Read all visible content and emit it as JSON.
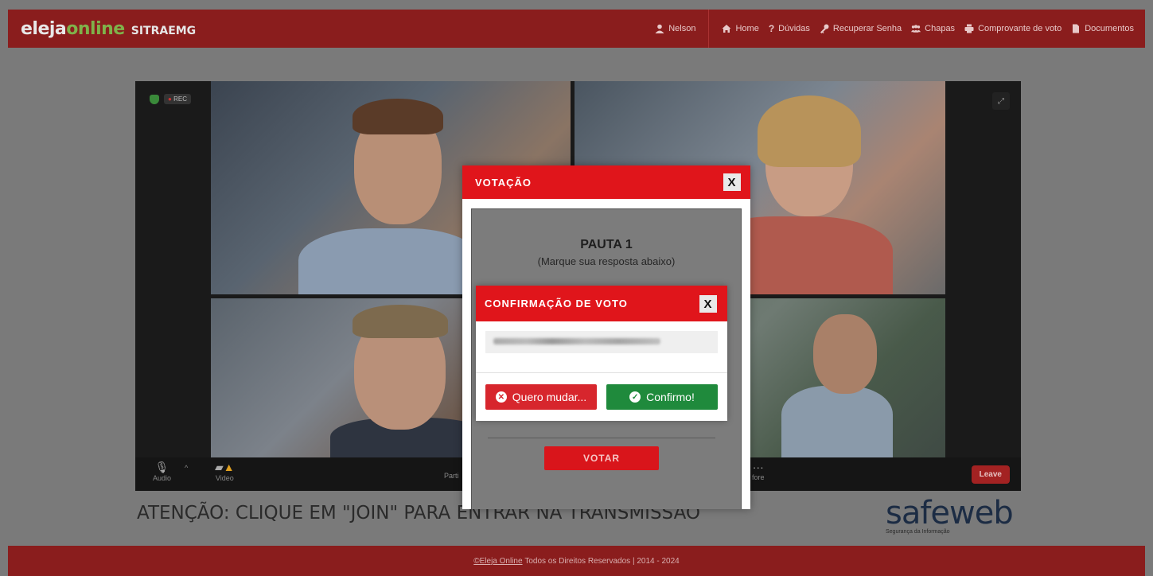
{
  "header": {
    "brand_main": "eleja",
    "brand_accent": "online",
    "brand_sub": "SITRAEMG",
    "user_name": "Nelson",
    "nav": {
      "home": "Home",
      "duvidas": "Dúvidas",
      "recuperar": "Recuperar Senha",
      "chapas": "Chapas",
      "comprovante": "Comprovante de voto",
      "documentos": "Documentos"
    }
  },
  "video": {
    "rec_label": "REC",
    "controls": {
      "audio": "Audio",
      "video": "Video",
      "participants": "Parti",
      "more": "fore",
      "leave": "Leave"
    }
  },
  "attention_text": "ATENÇÃO: CLIQUE EM \"JOIN\" PARA ENTRAR NA TRANSMISSÃO",
  "safeweb": {
    "logo": "safeweb",
    "tagline": "Segurança da Informação"
  },
  "modal": {
    "title": "VOTAÇÃO",
    "close": "X",
    "pauta_title": "PAUTA 1",
    "pauta_subtitle": "(Marque sua resposta abaixo)",
    "vote_button": "VOTAR"
  },
  "confirm": {
    "title": "CONFIRMAÇÃO DE VOTO",
    "close": "X",
    "change_button": "Quero mudar...",
    "confirm_button": "Confirmo!"
  },
  "footer": {
    "copyright_link": "©Eleja Online",
    "text": "Todos os Direitos Reservados  |  2014 - 2024"
  },
  "colors": {
    "primary_red": "#e0151b",
    "header_dark_red": "#8a1d1d",
    "confirm_green": "#1f8a3c",
    "brand_green": "#7fb24a"
  }
}
